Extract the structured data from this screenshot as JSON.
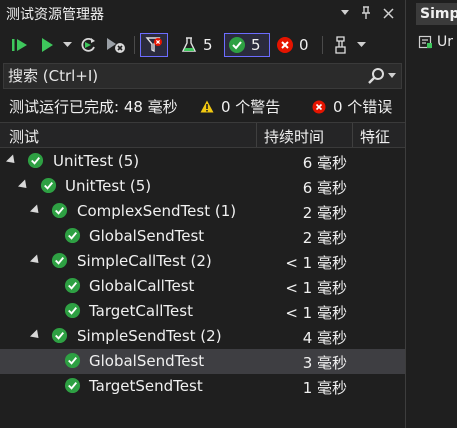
{
  "window": {
    "title": "测试资源管理器"
  },
  "toolbar": {
    "passed_count": "5",
    "passed_filter_count": "5",
    "failed_count": "0"
  },
  "search": {
    "placeholder": "搜索 (Ctrl+I)"
  },
  "status": {
    "summary": "测试运行已完成: 48 毫秒",
    "warnings": "0 个警告",
    "errors": "0 个错误"
  },
  "columns": {
    "test": "测试",
    "duration": "持续时间",
    "traits": "特征"
  },
  "tree": [
    {
      "name": "UnitTest (5)",
      "duration": "6 毫秒",
      "level": 0,
      "expanded": true,
      "selected": false
    },
    {
      "name": "UnitTest (5)",
      "duration": "6 毫秒",
      "level": 1,
      "expanded": true,
      "selected": false
    },
    {
      "name": "ComplexSendTest (1)",
      "duration": "2 毫秒",
      "level": 2,
      "expanded": true,
      "selected": false
    },
    {
      "name": "GlobalSendTest",
      "duration": "2 毫秒",
      "level": 3,
      "expanded": false,
      "selected": false
    },
    {
      "name": "SimpleCallTest (2)",
      "duration": "< 1 毫秒",
      "level": 2,
      "expanded": true,
      "selected": false
    },
    {
      "name": "GlobalCallTest",
      "duration": "< 1 毫秒",
      "level": 3,
      "expanded": false,
      "selected": false
    },
    {
      "name": "TargetCallTest",
      "duration": "< 1 毫秒",
      "level": 3,
      "expanded": false,
      "selected": false
    },
    {
      "name": "SimpleSendTest (2)",
      "duration": "4 毫秒",
      "level": 2,
      "expanded": true,
      "selected": false
    },
    {
      "name": "GlobalSendTest",
      "duration": "3 毫秒",
      "level": 3,
      "expanded": false,
      "selected": true
    },
    {
      "name": "TargetSendTest",
      "duration": "1 毫秒",
      "level": 3,
      "expanded": false,
      "selected": false
    }
  ],
  "right_pane": {
    "tab_label": "Simp",
    "item_label": "Ur"
  },
  "colors": {
    "pass": "#2ea043",
    "fail": "#e51400",
    "warn": "#f2c811",
    "accent": "#6c6cff",
    "run": "#3ec75c"
  }
}
